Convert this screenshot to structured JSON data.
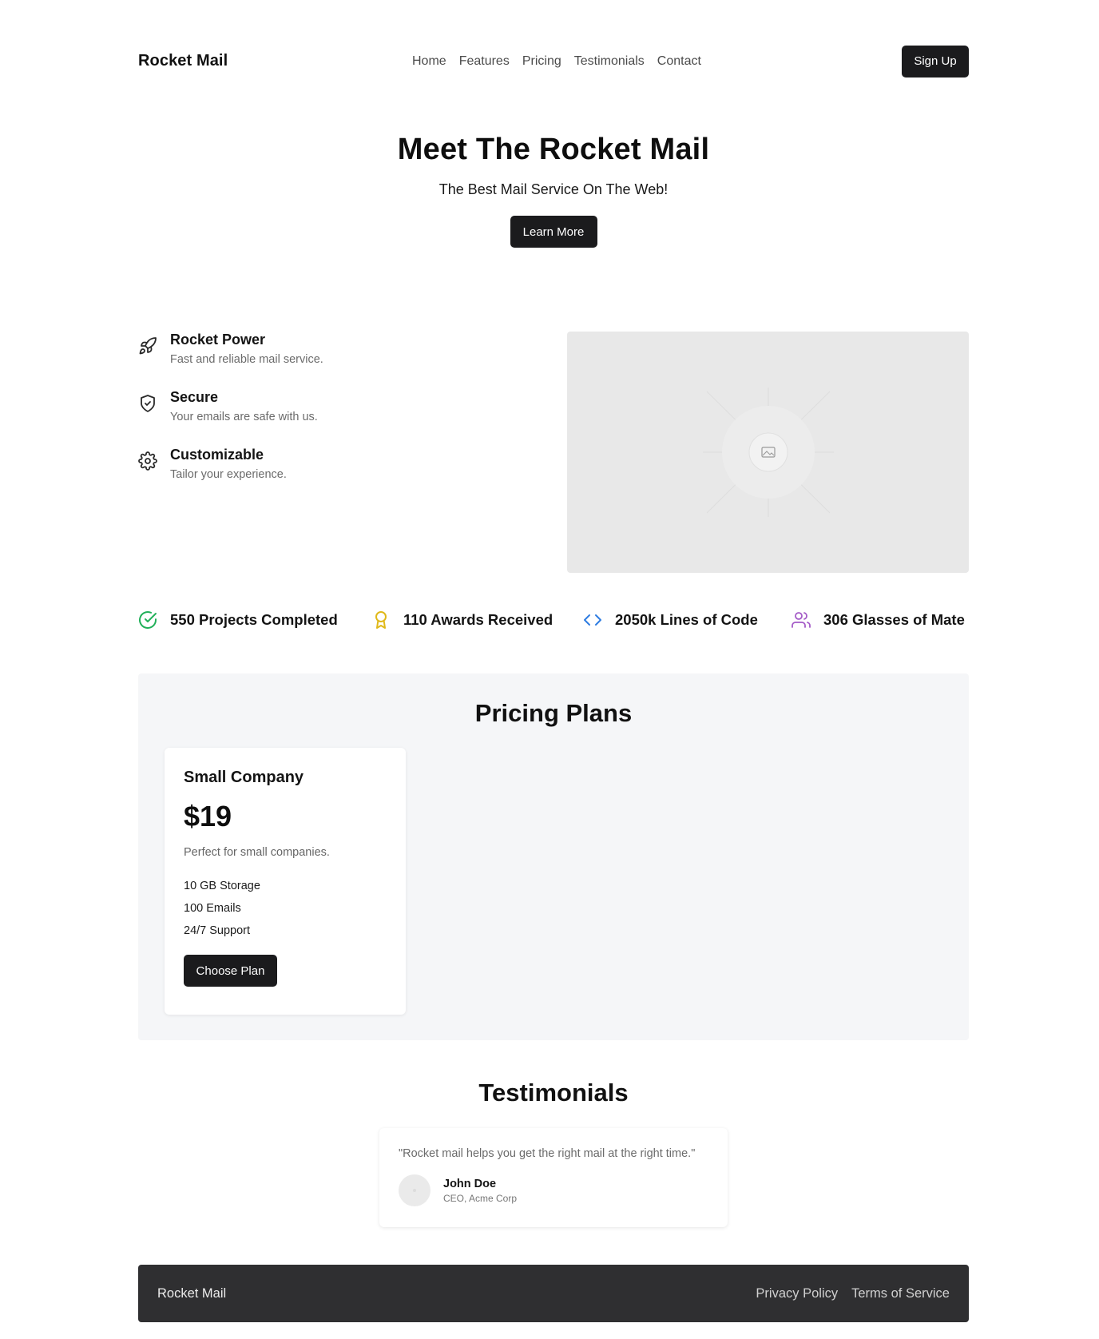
{
  "nav": {
    "brand": "Rocket Mail",
    "links": [
      "Home",
      "Features",
      "Pricing",
      "Testimonials",
      "Contact"
    ],
    "signup": "Sign Up"
  },
  "hero": {
    "title": "Meet The Rocket Mail",
    "subtitle": "The Best Mail Service On The Web!",
    "cta": "Learn More"
  },
  "features": [
    {
      "title": "Rocket Power",
      "desc": "Fast and reliable mail service.",
      "icon": "rocket-icon"
    },
    {
      "title": "Secure",
      "desc": "Your emails are safe with us.",
      "icon": "shield-icon"
    },
    {
      "title": "Customizable",
      "desc": "Tailor your experience.",
      "icon": "gear-icon"
    }
  ],
  "stats": [
    {
      "label": "550 Projects Completed",
      "icon": "check-circle-icon",
      "color": "#22b05a"
    },
    {
      "label": "110 Awards Received",
      "icon": "award-icon",
      "color": "#e0b91a"
    },
    {
      "label": "2050k Lines of Code",
      "icon": "code-icon",
      "color": "#2f7de1"
    },
    {
      "label": "306 Glasses of Mate",
      "icon": "users-icon",
      "color": "#a45bc7"
    }
  ],
  "pricing": {
    "heading": "Pricing Plans",
    "plan": {
      "name": "Small Company",
      "price": "$19",
      "desc": "Perfect for small companies.",
      "features": [
        "10 GB Storage",
        "100 Emails",
        "24/7 Support"
      ],
      "cta": "Choose Plan"
    }
  },
  "testimonials": {
    "heading": "Testimonials",
    "quote": "\"Rocket mail helps you get the right mail at the right time.\"",
    "name": "John Doe",
    "role": "CEO, Acme Corp"
  },
  "footer": {
    "brand": "Rocket Mail",
    "links": [
      "Privacy Policy",
      "Terms of Service"
    ]
  }
}
